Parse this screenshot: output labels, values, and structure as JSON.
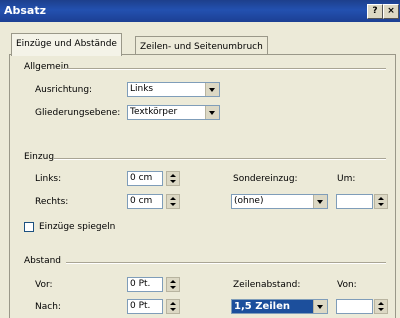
{
  "window": {
    "title": "Absatz",
    "help_button": "?",
    "close_button": "×"
  },
  "tabs": [
    {
      "label": "Einzüge und Abstände"
    },
    {
      "label": "Zeilen- und Seitenumbruch"
    }
  ],
  "allgemein": {
    "group_label": "Allgemein",
    "ausrichtung_label": "Ausrichtung:",
    "ausrichtung_value": "Links",
    "gliederungsebene_label": "Gliederungsebene:",
    "gliederungsebene_value": "Textkörper"
  },
  "einzug": {
    "group_label": "Einzug",
    "links_label": "Links:",
    "links_value": "0 cm",
    "rechts_label": "Rechts:",
    "rechts_value": "0 cm",
    "sondereinzug_label": "Sondereinzug:",
    "sondereinzug_value": "(ohne)",
    "um_label": "Um:",
    "um_value": "",
    "spiegeln_label": "Einzüge spiegeln",
    "spiegeln_checked": false
  },
  "abstand": {
    "group_label": "Abstand",
    "vor_label": "Vor:",
    "vor_value": "0 Pt.",
    "nach_label": "Nach:",
    "nach_value": "0 Pt.",
    "zeilenabstand_label": "Zeilenabstand:",
    "zeilenabstand_value": "1,5 Zeilen",
    "von_label": "Von:",
    "von_value": ""
  }
}
